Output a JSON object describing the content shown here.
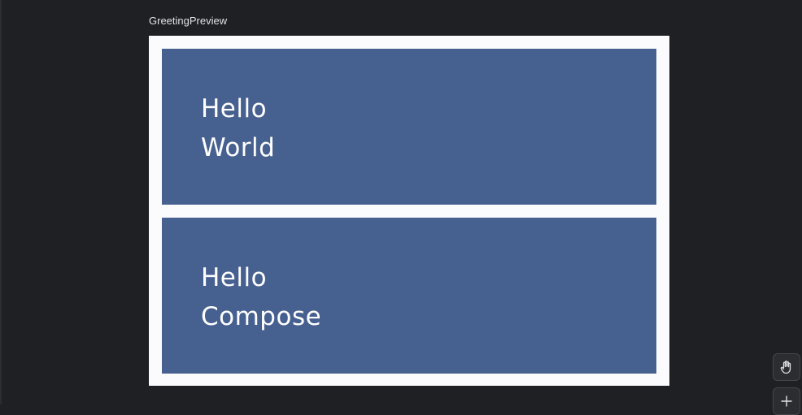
{
  "preview": {
    "label": "GreetingPreview",
    "background": "#fbfbfd",
    "cards": [
      {
        "color": "#46608f",
        "lines": [
          "Hello",
          "World"
        ]
      },
      {
        "color": "#46608f",
        "lines": [
          "Hello",
          "Compose"
        ]
      }
    ]
  },
  "toolbar": {
    "buttons": [
      {
        "name": "pan-tool-button",
        "icon": "hand-icon"
      },
      {
        "name": "zoom-in-button",
        "icon": "plus-icon"
      }
    ]
  },
  "colors": {
    "ide_background": "#1f2023",
    "label_text": "#dfe1e5",
    "card_text": "#ffffff"
  }
}
